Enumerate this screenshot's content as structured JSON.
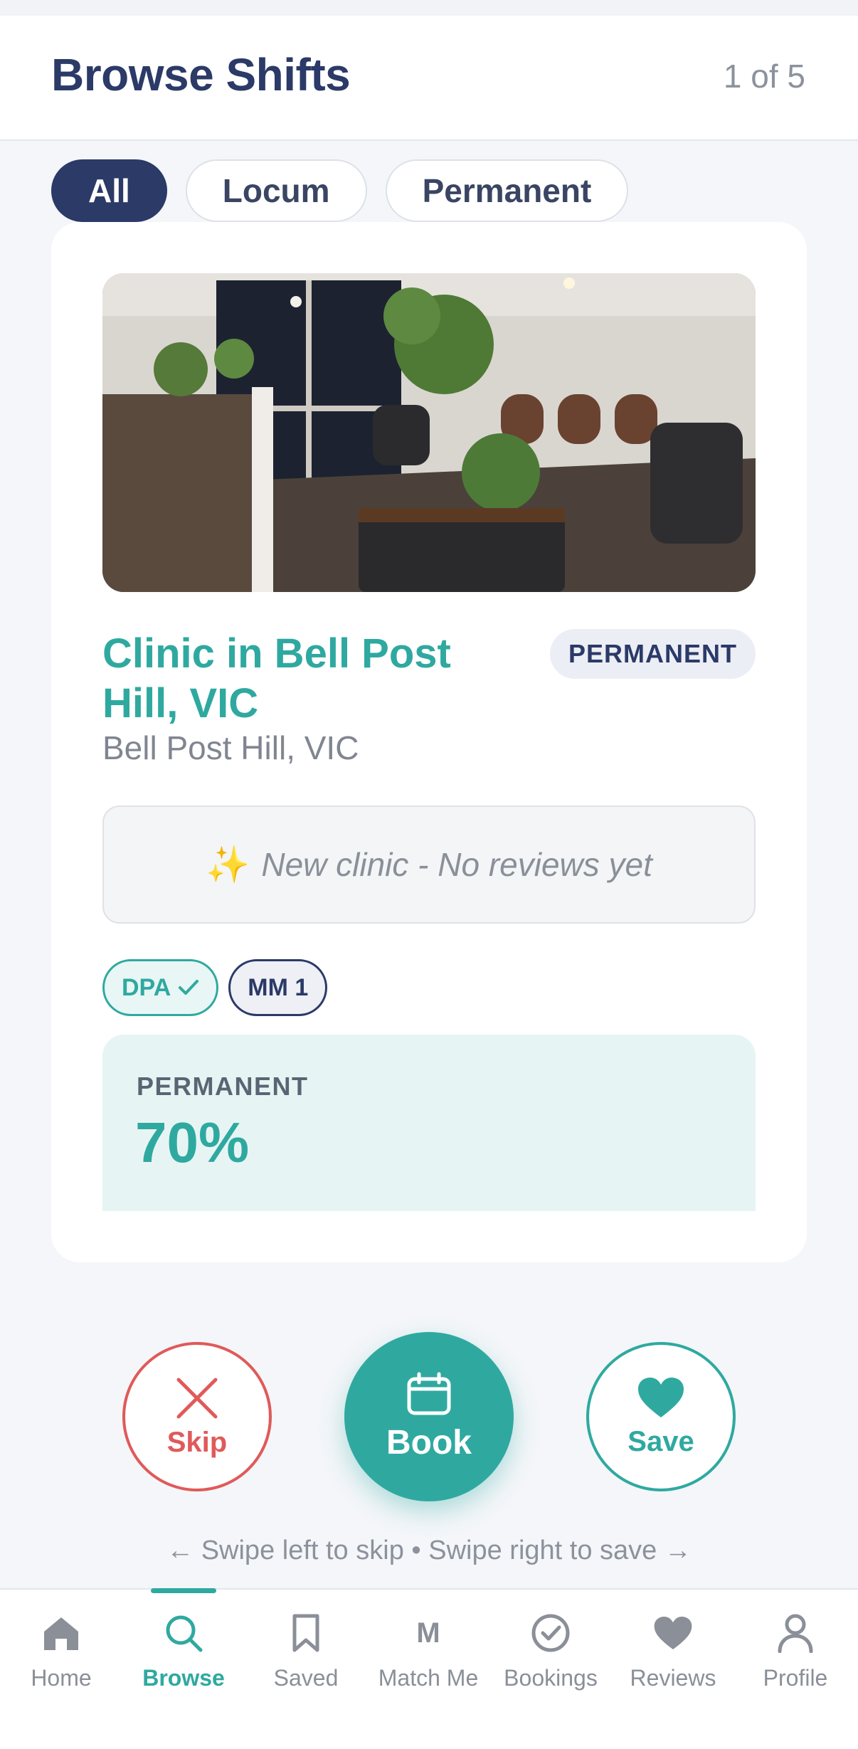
{
  "header": {
    "title": "Browse Shifts",
    "counter": "1 of 5"
  },
  "filters": [
    {
      "label": "All",
      "active": true
    },
    {
      "label": "Locum",
      "active": false
    },
    {
      "label": "Permanent",
      "active": false
    }
  ],
  "card": {
    "clinic_name": "Clinic in Bell Post Hill, VIC",
    "type_badge": "PERMANENT",
    "location": "Bell Post Hill, VIC",
    "review_text": "New clinic - No reviews yet",
    "tags": [
      "DPA",
      "MM 1"
    ],
    "rate_label": "PERMANENT",
    "rate_value": "70%"
  },
  "actions": {
    "skip": "Skip",
    "book": "Book",
    "save": "Save"
  },
  "hint": "← Swipe left to skip • Swipe right to save →",
  "tabs": [
    {
      "label": "Home",
      "icon": "home-icon"
    },
    {
      "label": "Browse",
      "icon": "search-icon",
      "active": true
    },
    {
      "label": "Saved",
      "icon": "bookmark-icon"
    },
    {
      "label": "Match Me",
      "icon": "m-letter-icon"
    },
    {
      "label": "Bookings",
      "icon": "check-circle-icon"
    },
    {
      "label": "Reviews",
      "icon": "heart-icon"
    },
    {
      "label": "Profile",
      "icon": "person-icon"
    }
  ],
  "colors": {
    "primary": "#2b3a67",
    "accent": "#2fa9a0",
    "danger": "#e05a5a"
  }
}
